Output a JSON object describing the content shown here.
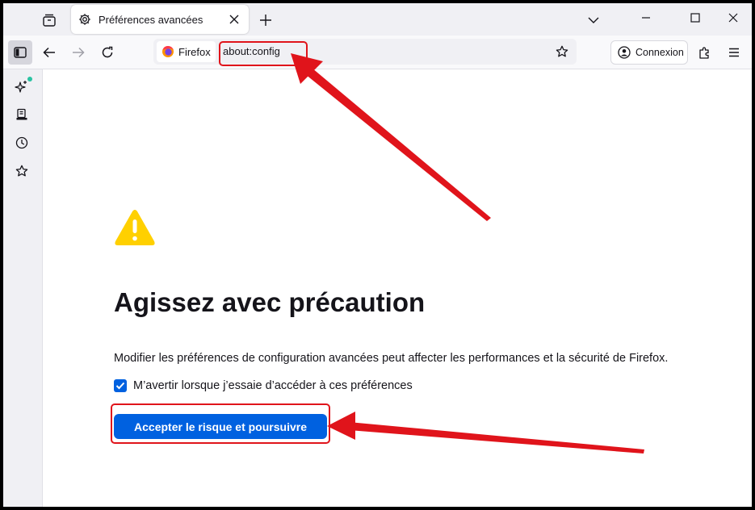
{
  "tab": {
    "title": "Préférences avancées",
    "icon": "gear-icon"
  },
  "urlbar": {
    "identity_label": "Firefox",
    "url": "about:config"
  },
  "account": {
    "label": "Connexion"
  },
  "content": {
    "title": "Agissez avec précaution",
    "description": "Modifier les préférences de configuration avancées peut affecter les performances et la sécurité de Firefox.",
    "checkbox_label": "M’avertir lorsque j’essaie d’accéder à ces préférences",
    "checkbox_checked": true,
    "accept_label": "Accepter le risque et poursuivre"
  },
  "colors": {
    "accent": "#0061e0",
    "warning": "#ffd000",
    "annotation": "#e0141b"
  }
}
